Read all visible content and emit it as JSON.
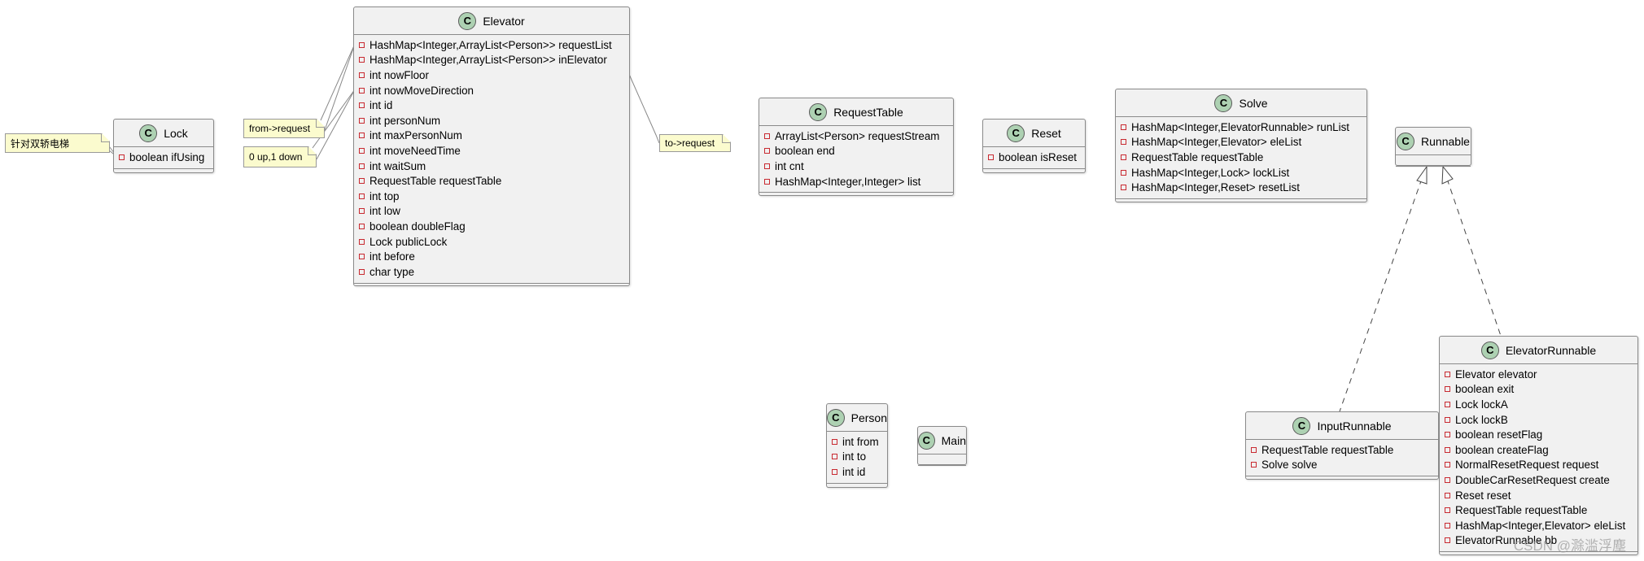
{
  "classes": [
    {
      "id": "lock",
      "name": "Lock",
      "stereotype_letter": "C",
      "fields": [
        "boolean ifUsing"
      ]
    },
    {
      "id": "elevator",
      "name": "Elevator",
      "stereotype_letter": "C",
      "fields": [
        "HashMap<Integer,ArrayList<Person>> requestList",
        "HashMap<Integer,ArrayList<Person>> inElevator",
        "int nowFloor",
        "int nowMoveDirection",
        "int id",
        "int personNum",
        "int maxPersonNum",
        "int moveNeedTime",
        "int waitSum",
        "RequestTable requestTable",
        "int top",
        "int low",
        "boolean doubleFlag",
        "Lock publicLock",
        "int before",
        "char type"
      ]
    },
    {
      "id": "requesttable",
      "name": "RequestTable",
      "stereotype_letter": "C",
      "fields": [
        "ArrayList<Person> requestStream",
        "boolean end",
        "int cnt",
        "HashMap<Integer,Integer> list"
      ]
    },
    {
      "id": "reset",
      "name": "Reset",
      "stereotype_letter": "C",
      "fields": [
        "boolean isReset"
      ]
    },
    {
      "id": "solve",
      "name": "Solve",
      "stereotype_letter": "C",
      "fields": [
        "HashMap<Integer,ElevatorRunnable> runList",
        "HashMap<Integer,Elevator> eleList",
        "RequestTable requestTable",
        "HashMap<Integer,Lock> lockList",
        "HashMap<Integer,Reset> resetList"
      ]
    },
    {
      "id": "runnable",
      "name": "Runnable",
      "stereotype_letter": "C",
      "fields": []
    },
    {
      "id": "inputrunnable",
      "name": "InputRunnable",
      "stereotype_letter": "C",
      "fields": [
        "RequestTable requestTable",
        "Solve solve"
      ]
    },
    {
      "id": "elevatorrunnable",
      "name": "ElevatorRunnable",
      "stereotype_letter": "C",
      "fields": [
        "Elevator elevator",
        "boolean exit",
        "Lock lockA",
        "Lock lockB",
        "boolean resetFlag",
        "boolean createFlag",
        "NormalResetRequest request",
        "DoubleCarResetRequest create",
        "Reset reset",
        "RequestTable requestTable",
        "HashMap<Integer,Elevator> eleList",
        "ElevatorRunnable bb"
      ]
    },
    {
      "id": "person",
      "name": "Person",
      "stereotype_letter": "C",
      "fields": [
        "int from",
        "int to",
        "int id"
      ]
    },
    {
      "id": "main",
      "name": "Main",
      "stereotype_letter": "C",
      "fields": []
    }
  ],
  "notes": [
    {
      "id": "note-lock",
      "text": "针对双轿电梯"
    },
    {
      "id": "note-from",
      "text": "from->request"
    },
    {
      "id": "note-dir",
      "text": "0 up,1 down"
    },
    {
      "id": "note-to",
      "text": "to->request"
    }
  ],
  "relations": [
    {
      "from": "InputRunnable",
      "to": "Runnable",
      "type": "realization"
    },
    {
      "from": "ElevatorRunnable",
      "to": "Runnable",
      "type": "realization"
    }
  ],
  "watermark": "CSDN @滁滥浮塵",
  "colors": {
    "class_fill": "#f1f1f1",
    "class_icon": "#add1b2",
    "private_marker": "#c82930",
    "note_fill": "#fbfbce"
  }
}
